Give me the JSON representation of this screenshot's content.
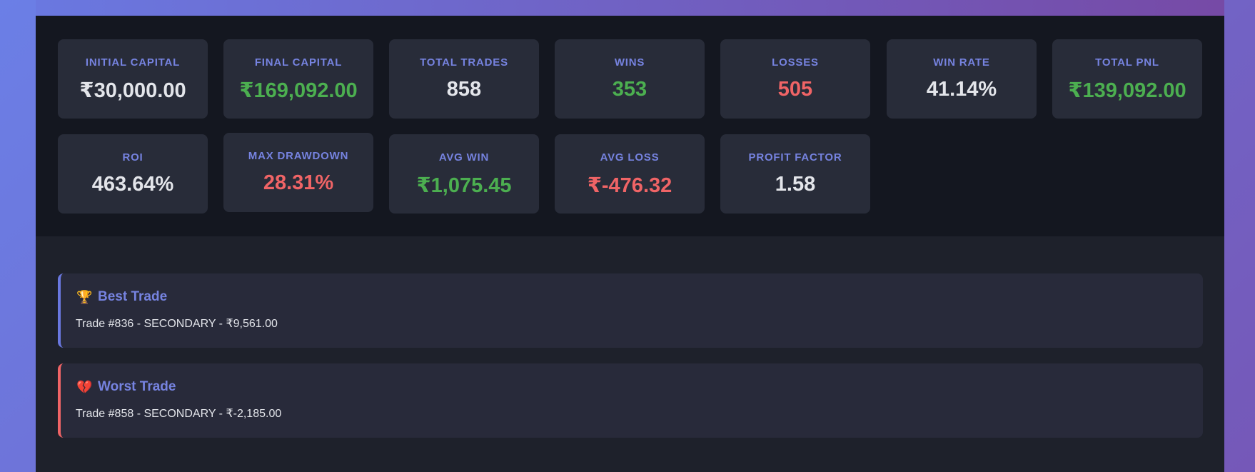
{
  "stats": [
    {
      "label": "INITIAL CAPITAL",
      "value": "₹30,000.00",
      "tone": "neutral"
    },
    {
      "label": "FINAL CAPITAL",
      "value": "₹169,092.00",
      "tone": "positive"
    },
    {
      "label": "TOTAL TRADES",
      "value": "858",
      "tone": "neutral"
    },
    {
      "label": "WINS",
      "value": "353",
      "tone": "positive"
    },
    {
      "label": "LOSSES",
      "value": "505",
      "tone": "negative"
    },
    {
      "label": "WIN RATE",
      "value": "41.14%",
      "tone": "neutral"
    },
    {
      "label": "TOTAL PNL",
      "value": "₹139,092.00",
      "tone": "positive"
    },
    {
      "label": "ROI",
      "value": "463.64%",
      "tone": "neutral"
    },
    {
      "label": "MAX DRAWDOWN",
      "value": "28.31%",
      "tone": "negative"
    },
    {
      "label": "AVG WIN",
      "value": "₹1,075.45",
      "tone": "positive"
    },
    {
      "label": "AVG LOSS",
      "value": "₹-476.32",
      "tone": "negative"
    },
    {
      "label": "PROFIT FACTOR",
      "value": "1.58",
      "tone": "neutral"
    }
  ],
  "best_trade": {
    "icon": "🏆",
    "title": "Best Trade",
    "detail": "Trade #836 - SECONDARY - ₹9,561.00"
  },
  "worst_trade": {
    "icon": "💔",
    "title": "Worst Trade",
    "detail": "Trade #858 - SECONDARY - ₹-2,185.00"
  },
  "colors": {
    "accent": "#6a78e0",
    "positive": "#4caf50",
    "negative": "#f06466"
  }
}
